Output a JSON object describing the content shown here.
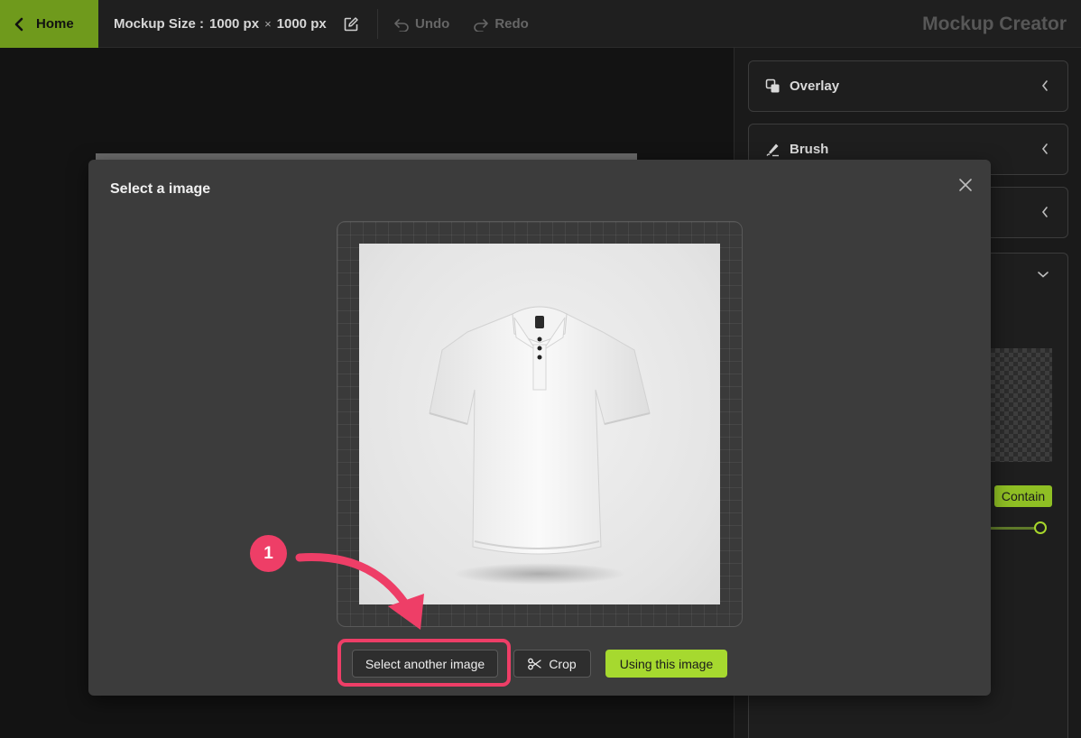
{
  "header": {
    "home_label": "Home",
    "size_label": "Mockup Size :",
    "width": "1000 px",
    "times": "×",
    "height": "1000 px",
    "undo_label": "Undo",
    "redo_label": "Redo",
    "app_title": "Mockup Creator"
  },
  "right_panel": {
    "items": [
      {
        "label": "Overlay",
        "icon": "overlay-icon"
      },
      {
        "label": "Brush",
        "icon": "brush-icon"
      }
    ],
    "contain_label": "Contain"
  },
  "modal": {
    "title": "Select a image",
    "buttons": {
      "select_another": "Select another image",
      "crop": "Crop",
      "use": "Using this image"
    }
  },
  "annotation": {
    "step": "1"
  },
  "colors": {
    "accent": "#a6d92f",
    "home_bg": "#6f9a1c",
    "highlight": "#ee3e67"
  }
}
